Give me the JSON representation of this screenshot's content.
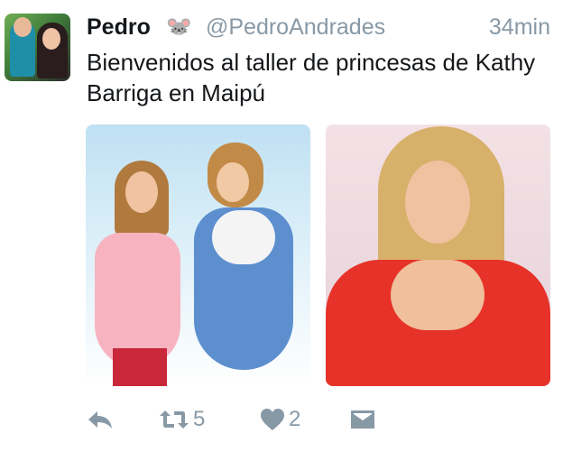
{
  "tweet": {
    "display_name": "Pedro",
    "name_emoji": "🐭",
    "handle": "@PedroAndrades",
    "timestamp": "34min",
    "text": "Bienvenidos al taller de princesas de Kathy Barriga en Maipú",
    "photos": [
      {
        "icon": "photo-two-princesses"
      },
      {
        "icon": "photo-woman-heart-hands"
      }
    ]
  },
  "actions": {
    "reply": {
      "icon": "reply-icon"
    },
    "retweet": {
      "icon": "retweet-icon",
      "count": "5"
    },
    "like": {
      "icon": "heart-icon",
      "count": "2"
    },
    "message": {
      "icon": "direct-message-icon"
    }
  },
  "colors": {
    "text": "#14171a",
    "secondary": "#8899a6",
    "background": "#ffffff"
  }
}
